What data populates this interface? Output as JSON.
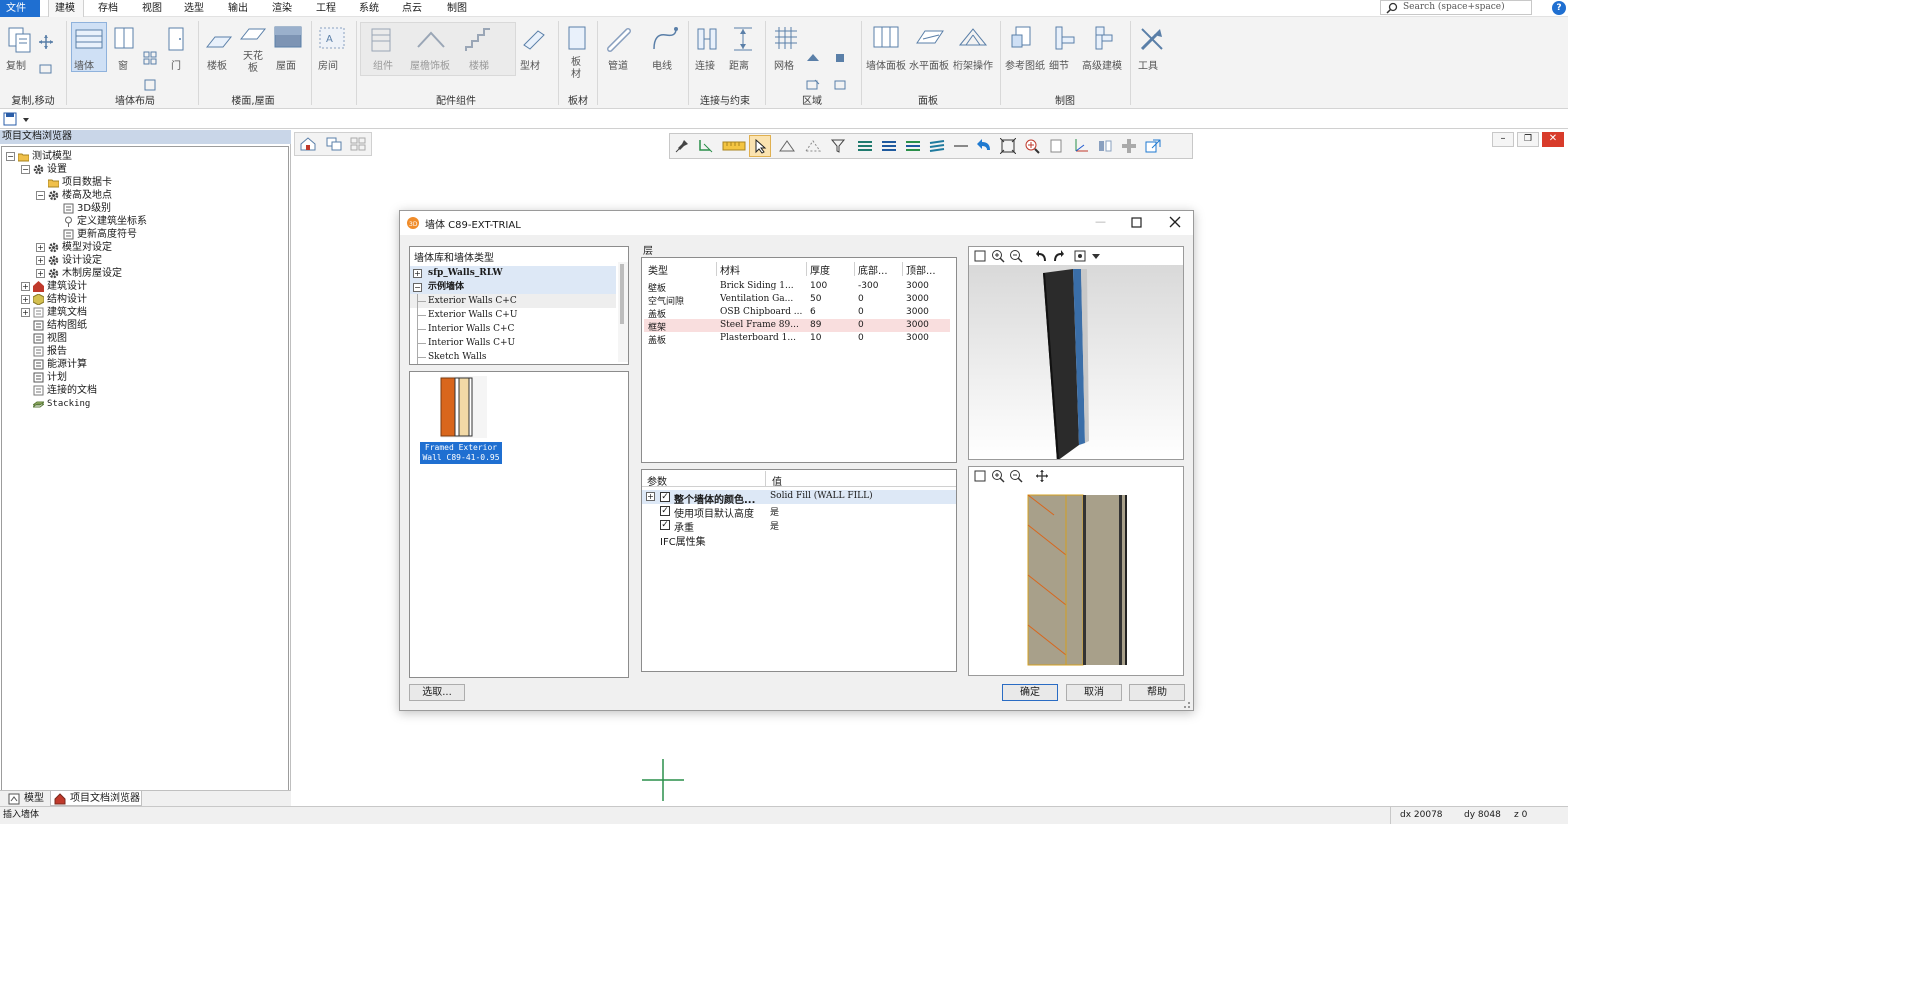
{
  "menubar": {
    "items": [
      "文件",
      "建模",
      "存档",
      "视图",
      "选型",
      "输出",
      "渲染",
      "工程",
      "系统",
      "点云",
      "制图"
    ],
    "search_placeholder": "Search (space+space)",
    "help": "?"
  },
  "ribbon": {
    "groups": [
      {
        "label": "复制,移动",
        "buttons": [
          "复制"
        ]
      },
      {
        "label": "墙体布局",
        "buttons": [
          "墙体",
          "窗",
          "门"
        ]
      },
      {
        "label": "楼面,屋面",
        "buttons": [
          "楼板",
          "天花板",
          "屋面"
        ]
      },
      {
        "label": "",
        "buttons": [
          "房间"
        ]
      },
      {
        "label": "配件组件",
        "buttons": [
          "组件",
          "屋檐饰板",
          "楼梯",
          "型材"
        ]
      },
      {
        "label": "板材",
        "buttons": [
          "板材"
        ]
      },
      {
        "label": "",
        "buttons": [
          "管道",
          "电线"
        ]
      },
      {
        "label": "连接与约束",
        "buttons": [
          "连接",
          "距离"
        ]
      },
      {
        "label": "区域",
        "buttons": [
          "网格"
        ]
      },
      {
        "label": "面板",
        "buttons": [
          "墙体面板",
          "水平面板",
          "桁架操作"
        ]
      },
      {
        "label": "制图",
        "buttons": [
          "参考图纸",
          "细节",
          "高级建模"
        ]
      },
      {
        "label": "",
        "buttons": [
          "工具"
        ]
      }
    ]
  },
  "left_panel": {
    "title": "项目文档浏览器",
    "tree": [
      {
        "label": "测试模型",
        "level": 0,
        "expander": "−",
        "icon": "folder-icon"
      },
      {
        "label": "设置",
        "level": 1,
        "expander": "−",
        "icon": "gear-icon"
      },
      {
        "label": "项目数据卡",
        "level": 2,
        "expander": "",
        "icon": "folder-icon"
      },
      {
        "label": "楼高及地点",
        "level": 2,
        "expander": "−",
        "icon": "gear-icon"
      },
      {
        "label": "3D级别",
        "level": 3,
        "expander": "",
        "icon": "levels-icon"
      },
      {
        "label": "定义建筑坐标系",
        "level": 3,
        "expander": "",
        "icon": "pin-icon"
      },
      {
        "label": "更新高度符号",
        "level": 3,
        "expander": "",
        "icon": "height-icon"
      },
      {
        "label": "模型对设定",
        "level": 2,
        "expander": "+",
        "icon": "gear-icon"
      },
      {
        "label": "设计设定",
        "level": 2,
        "expander": "+",
        "icon": "gear-icon"
      },
      {
        "label": "木制房屋设定",
        "level": 2,
        "expander": "+",
        "icon": "gear-icon"
      },
      {
        "label": "建筑设计",
        "level": 1,
        "expander": "+",
        "icon": "house-icon"
      },
      {
        "label": "结构设计",
        "level": 1,
        "expander": "+",
        "icon": "cube-icon"
      },
      {
        "label": "建筑文档",
        "level": 1,
        "expander": "+",
        "icon": "doc-icon"
      },
      {
        "label": "结构图纸",
        "level": 1,
        "expander": "",
        "icon": "sheet-icon"
      },
      {
        "label": "视图",
        "level": 1,
        "expander": "",
        "icon": "view-icon"
      },
      {
        "label": "报告",
        "level": 1,
        "expander": "",
        "icon": "report-icon"
      },
      {
        "label": "能源计算",
        "level": 1,
        "expander": "",
        "icon": "energy-icon"
      },
      {
        "label": "计划",
        "level": 1,
        "expander": "",
        "icon": "plan-icon"
      },
      {
        "label": "连接的文档",
        "level": 1,
        "expander": "",
        "icon": "linked-doc-icon"
      },
      {
        "label": "Stacking",
        "level": 1,
        "expander": "",
        "icon": "stacking-icon"
      }
    ],
    "tabs": [
      "模型",
      "项目文档浏览器"
    ]
  },
  "dialog": {
    "title": "墙体 C89-EXT-TRIAL",
    "library_header": "墙体库和墙体类型",
    "library_items": [
      {
        "label": "sfp_Walls_RLW",
        "expander": "+",
        "bold": true,
        "level": 0
      },
      {
        "label": "示例墙体",
        "expander": "−",
        "bold": true,
        "level": 0
      },
      {
        "label": "Exterior Walls C+C",
        "expander": "",
        "bold": false,
        "level": 1
      },
      {
        "label": "Exterior Walls C+U",
        "expander": "",
        "bold": false,
        "level": 1
      },
      {
        "label": "Interior Walls C+C",
        "expander": "",
        "bold": false,
        "level": 1
      },
      {
        "label": "Interior Walls C+U",
        "expander": "",
        "bold": false,
        "level": 1
      },
      {
        "label": "Sketch Walls",
        "expander": "",
        "bold": false,
        "level": 1
      }
    ],
    "thumbnail_caption": "Framed Exterior Wall C89-41-0.95",
    "select_button": "选取...",
    "layers_label": "层",
    "layers_columns": [
      "类型",
      "材料",
      "厚度",
      "底部...",
      "顶部..."
    ],
    "layers_rows": [
      [
        "壁板",
        "Brick Siding 1...",
        "100",
        "-300",
        "3000"
      ],
      [
        "空气间隙",
        "Ventilation Ga...",
        "50",
        "0",
        "3000"
      ],
      [
        "盖板",
        "OSB Chipboard ...",
        "6",
        "0",
        "3000"
      ],
      [
        "框架",
        "Steel Frame 89...",
        "89",
        "0",
        "3000"
      ],
      [
        "盖板",
        "Plasterboard 1...",
        "10",
        "0",
        "3000"
      ]
    ],
    "selected_layer_index": 3,
    "params_columns": [
      "参数",
      "值"
    ],
    "params_rows": [
      {
        "name": "整个墙体的颜色...",
        "value": "Solid Fill  (WALL FILL)",
        "checkbox": true,
        "expander": "+",
        "bold": true
      },
      {
        "name": "使用项目默认高度",
        "value": "是",
        "checkbox": true,
        "expander": "",
        "bold": false
      },
      {
        "name": "承重",
        "value": "是",
        "checkbox": true,
        "expander": "",
        "bold": false
      },
      {
        "name": "IFC属性集",
        "value": "",
        "checkbox": false,
        "expander": "",
        "bold": false
      }
    ],
    "ok_button": "确定",
    "cancel_button": "取消",
    "help_button": "帮助"
  },
  "statusbar": {
    "message": "插入墙体",
    "dx": "dx 20078",
    "dy": "dy 8048",
    "z": "z 0"
  },
  "colors": {
    "accent": "#1f6fd1",
    "selected_row": "#f9dede",
    "tree_header": "#c9d6e8"
  }
}
